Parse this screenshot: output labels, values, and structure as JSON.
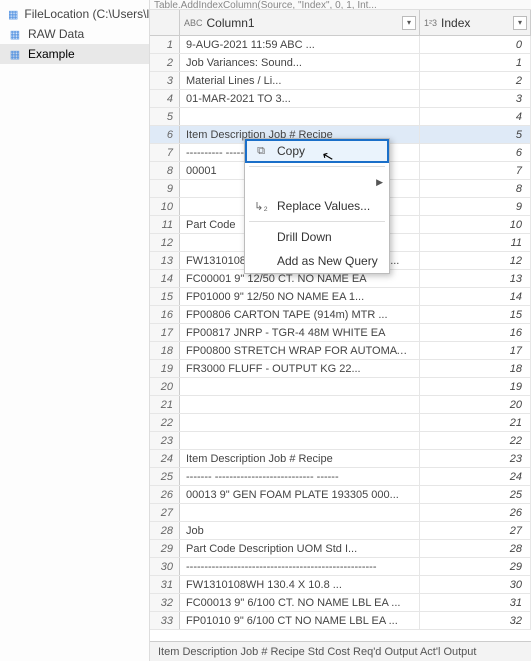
{
  "sidebar": {
    "items": [
      {
        "label": "FileLocation (C:\\Users\\lisde..."
      },
      {
        "label": "RAW Data"
      },
      {
        "label": "Example"
      }
    ]
  },
  "formula_snippet": "Table.AddIndexColumn(Source, \"Index\", 0, 1, Int...",
  "columns": [
    {
      "type_badge": "ABC",
      "name": "Column1"
    },
    {
      "type_badge": "1²3",
      "name": "Index"
    }
  ],
  "rows": [
    {
      "n": 1,
      "col1": "9-AUG-2021 11:59                           ABC ...",
      "col2": "0"
    },
    {
      "n": 2,
      "col1": "                        Job Variances: Sound...",
      "col2": "1"
    },
    {
      "n": 3,
      "col1": "                        Material Lines / Li...",
      "col2": "2"
    },
    {
      "n": 4,
      "col1": "                        01-MAR-2021 TO 3...",
      "col2": "3"
    },
    {
      "n": 5,
      "col1": "",
      "col2": "4"
    },
    {
      "n": 6,
      "col1": "Item    Description            Job #  Recipe",
      "col2": "5"
    },
    {
      "n": 7,
      "col1": "----------   -------------------------   --------",
      "col2": "6"
    },
    {
      "n": 8,
      "col1": "00001",
      "col2": "7"
    },
    {
      "n": 9,
      "col1": "",
      "col2": "8"
    },
    {
      "n": 10,
      "col1": "",
      "col2": "9"
    },
    {
      "n": 11,
      "col1": "   Part Code",
      "col2": "10"
    },
    {
      "n": 12,
      "col1": "",
      "col2": "11"
    },
    {
      "n": 13,
      "col1": "   FW1310108WH  130.4 X 10.8      WHITE KG  ...",
      "col2": "12"
    },
    {
      "n": 14,
      "col1": "   FC00001    9\" 12/50 CT. NO NAME    EA",
      "col2": "13"
    },
    {
      "n": 15,
      "col1": "   FP01000    9\" 12/50 NO NAME      EA    1...",
      "col2": "14"
    },
    {
      "n": 16,
      "col1": "   FP00806    CARTON TAPE (914m)      MTR  ...",
      "col2": "15"
    },
    {
      "n": 17,
      "col1": "   FP00817    JNRP - TGR-4 48M WHITE   EA",
      "col2": "16"
    },
    {
      "n": 18,
      "col1": "   FP00800    STRETCH WRAP FOR AUTOMATI...",
      "col2": "17"
    },
    {
      "n": 19,
      "col1": "   FR3000     FLUFF - OUTPUT       KG     22...",
      "col2": "18"
    },
    {
      "n": 20,
      "col1": "",
      "col2": "19"
    },
    {
      "n": 21,
      "col1": "",
      "col2": "20"
    },
    {
      "n": 22,
      "col1": "",
      "col2": "21"
    },
    {
      "n": 23,
      "col1": "",
      "col2": "22"
    },
    {
      "n": 24,
      "col1": "Item      Description            Job #  Recipe",
      "col2": "23"
    },
    {
      "n": 25,
      "col1": "-------    ---------------------------      ------",
      "col2": "24"
    },
    {
      "n": 26,
      "col1": "00013   9\" GEN FOAM PLATE         193305 000...",
      "col2": "25"
    },
    {
      "n": 27,
      "col1": "",
      "col2": "26"
    },
    {
      "n": 28,
      "col1": "                                 Job",
      "col2": "27"
    },
    {
      "n": 29,
      "col1": "   Part Code   Description           UOM   Std I...",
      "col2": "28"
    },
    {
      "n": 30,
      "col1": "   ----------------------------------------------------",
      "col2": "29"
    },
    {
      "n": 31,
      "col1": "   FW1310108WH  130.4 X 10.8         ...",
      "col2": "30"
    },
    {
      "n": 32,
      "col1": "   FC00013    9\" 6/100 CT. NO NAME LBL  EA  ...",
      "col2": "31"
    },
    {
      "n": 33,
      "col1": "   FP01010    9\" 6/100 CT NO NAME LBL   EA  ...",
      "col2": "32"
    }
  ],
  "context_menu": {
    "copy": "Copy",
    "replace": "Replace Values...",
    "drill": "Drill Down",
    "addquery": "Add as New Query"
  },
  "status_bar": "Item      Description         Job #  Recipe     Std Cost Req'd Output Act'l Output"
}
